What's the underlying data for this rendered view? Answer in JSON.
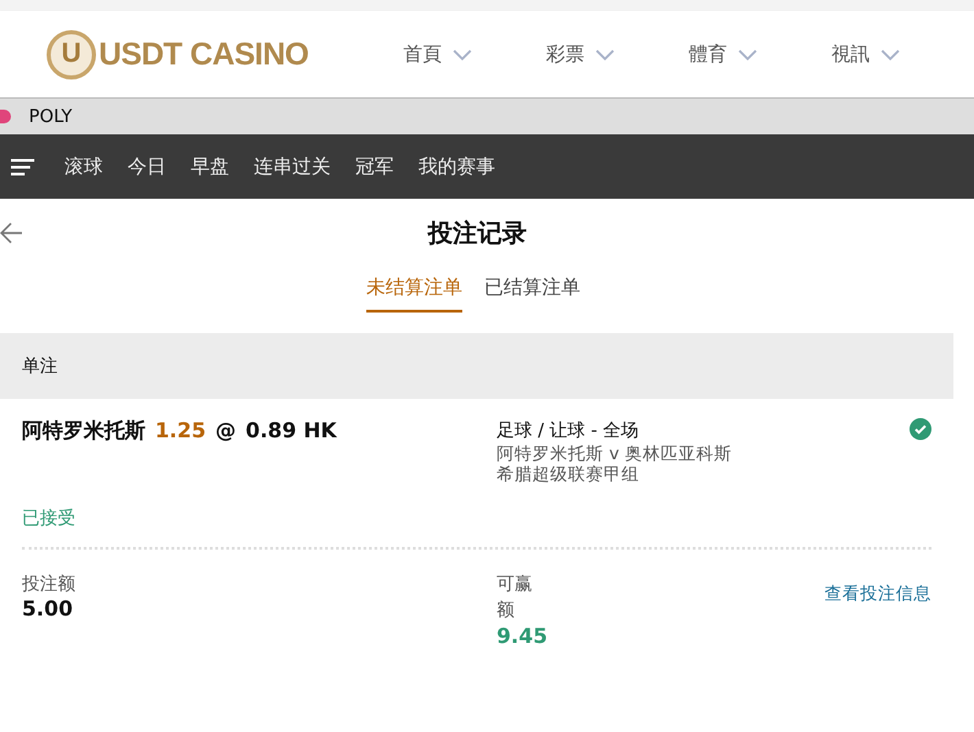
{
  "site_header": {
    "logo_mark": "U",
    "logo_text": "USDT CASINO",
    "nav": [
      {
        "label": "首頁"
      },
      {
        "label": "彩票"
      },
      {
        "label": "體育"
      },
      {
        "label": "視訊"
      }
    ]
  },
  "browser_tab": {
    "title": "POLY"
  },
  "sports_nav": {
    "items": [
      {
        "label": "滚球"
      },
      {
        "label": "今日"
      },
      {
        "label": "早盘"
      },
      {
        "label": "连串过关"
      },
      {
        "label": "冠军"
      },
      {
        "label": "我的赛事"
      }
    ]
  },
  "page_title": "投注记录",
  "tabs": [
    {
      "label": "未结算注单",
      "selected": true
    },
    {
      "label": "已结算注单",
      "selected": false
    }
  ],
  "section_title": "单注",
  "bet": {
    "selection": "阿特罗米托斯",
    "handicap": "1.25",
    "at": "@",
    "odds": "0.89 HK",
    "market": "足球 / 让球 - 全场",
    "match": "阿特罗米托斯 v 奥林匹亚科斯",
    "league": "希腊超级联赛甲组",
    "confirmed": true,
    "status": "已接受",
    "stake_label": "投注额",
    "stake": "5.00",
    "win_label": "可赢额",
    "win": "9.45",
    "details_link": "查看投注信息"
  }
}
